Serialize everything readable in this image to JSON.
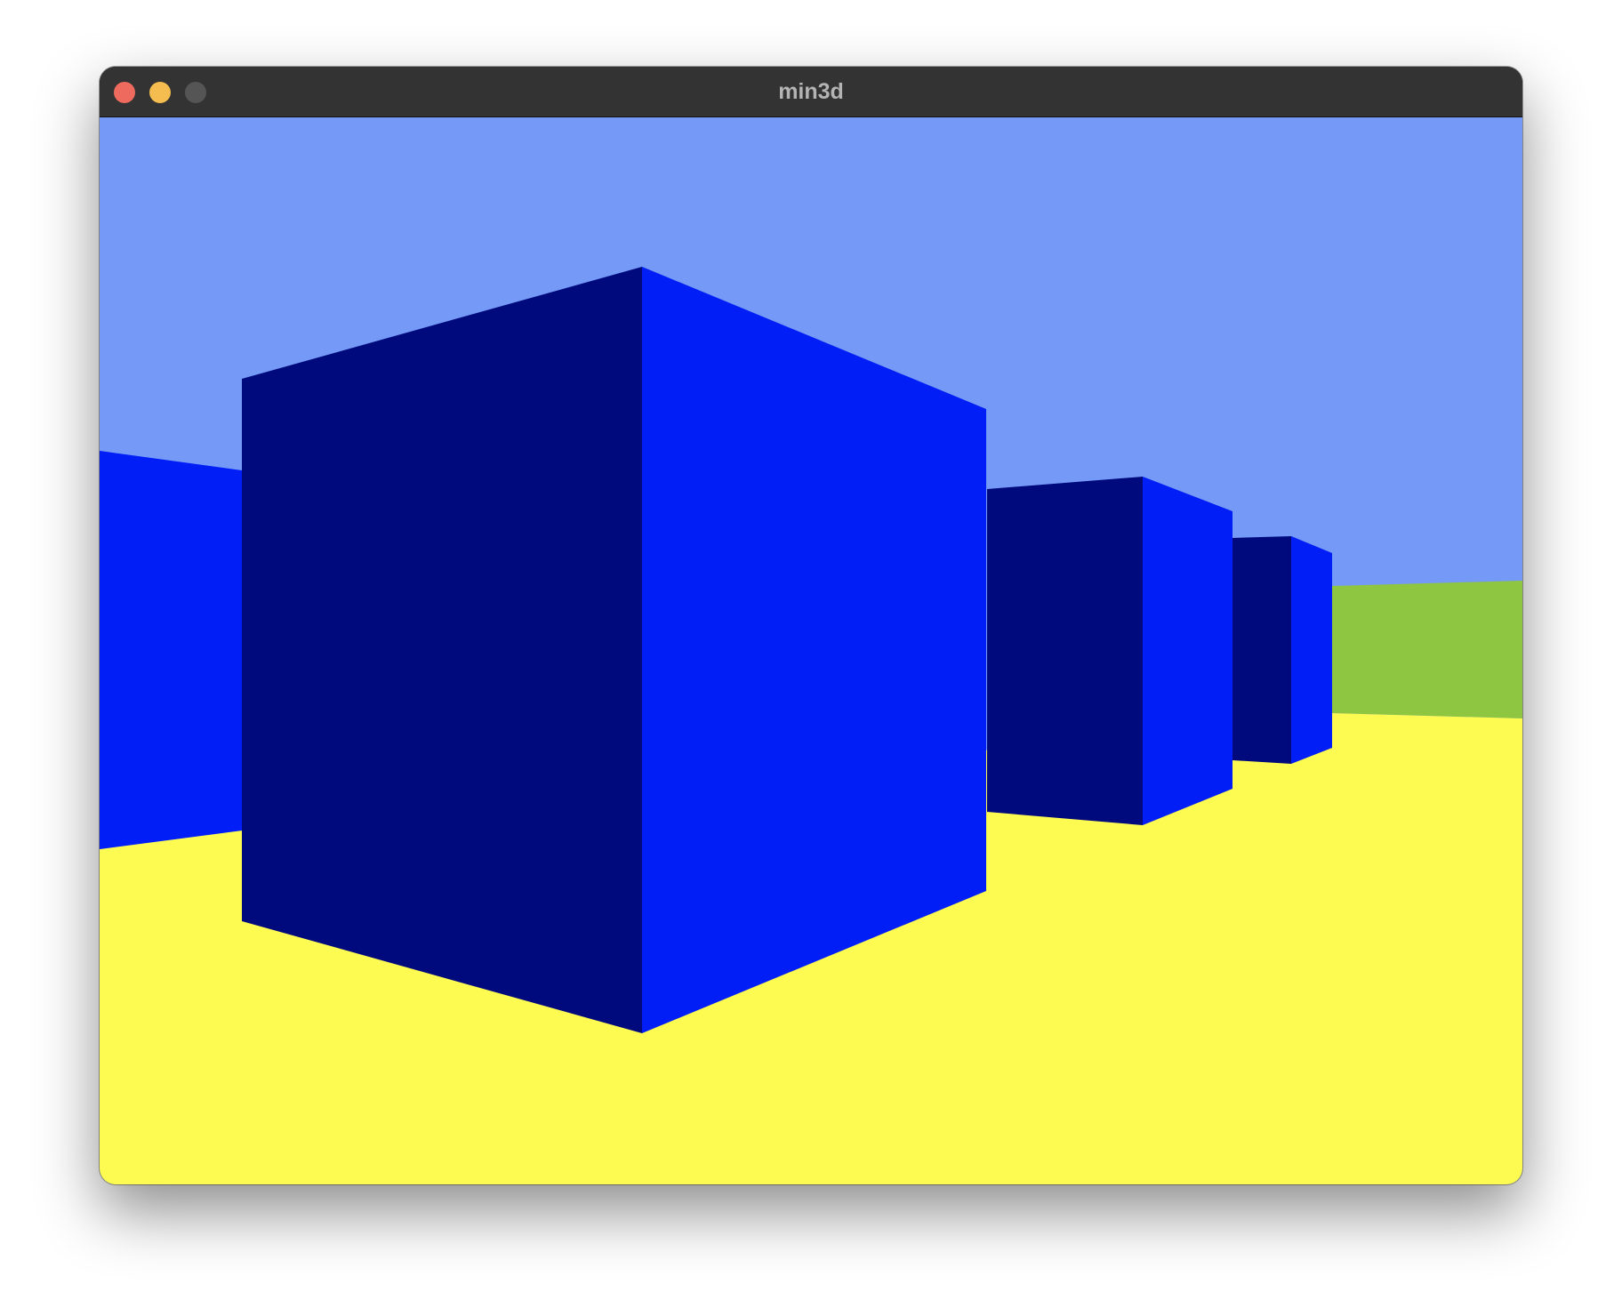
{
  "window": {
    "title": "min3d",
    "buttons": {
      "close": {
        "color": "#ee6a5e"
      },
      "minimize": {
        "color": "#f5bd4f"
      },
      "zoom": {
        "color": "#555555"
      }
    }
  },
  "scene": {
    "colors": {
      "sky": "#7499f7",
      "floor": "#fdfa52",
      "cube_face_dark": "#000a7d",
      "cube_face_bright": "#001ef5",
      "green_wall": "#8ec641"
    }
  }
}
